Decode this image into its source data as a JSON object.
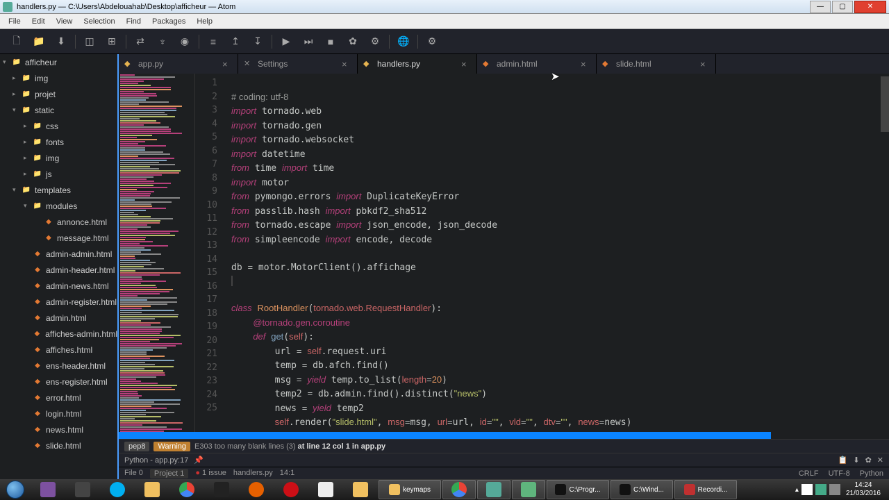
{
  "window": {
    "title": "handlers.py — C:\\Users\\Abdelouahab\\Desktop\\afficheur — Atom"
  },
  "menu": [
    "File",
    "Edit",
    "View",
    "Selection",
    "Find",
    "Packages",
    "Help"
  ],
  "tree": [
    {
      "l": "afficheur",
      "t": "folder",
      "i": 0,
      "c": "▾"
    },
    {
      "l": "img",
      "t": "folder",
      "i": 1,
      "c": "▸"
    },
    {
      "l": "projet",
      "t": "folder",
      "i": 1,
      "c": "▸"
    },
    {
      "l": "static",
      "t": "folder",
      "i": 1,
      "c": "▾"
    },
    {
      "l": "css",
      "t": "folder",
      "i": 2,
      "c": "▸"
    },
    {
      "l": "fonts",
      "t": "folder",
      "i": 2,
      "c": "▸"
    },
    {
      "l": "img",
      "t": "folder",
      "i": 2,
      "c": "▸"
    },
    {
      "l": "js",
      "t": "folder",
      "i": 2,
      "c": "▸"
    },
    {
      "l": "templates",
      "t": "folder",
      "i": 1,
      "c": "▾"
    },
    {
      "l": "modules",
      "t": "folder",
      "i": 2,
      "c": "▾"
    },
    {
      "l": "annonce.html",
      "t": "html",
      "i": 3,
      "c": ""
    },
    {
      "l": "message.html",
      "t": "html",
      "i": 3,
      "c": ""
    },
    {
      "l": "admin-admin.html",
      "t": "html",
      "i": 2,
      "c": ""
    },
    {
      "l": "admin-header.html",
      "t": "html",
      "i": 2,
      "c": ""
    },
    {
      "l": "admin-news.html",
      "t": "html",
      "i": 2,
      "c": ""
    },
    {
      "l": "admin-register.html",
      "t": "html",
      "i": 2,
      "c": ""
    },
    {
      "l": "admin.html",
      "t": "html",
      "i": 2,
      "c": ""
    },
    {
      "l": "affiches-admin.html",
      "t": "html",
      "i": 2,
      "c": ""
    },
    {
      "l": "affiches.html",
      "t": "html",
      "i": 2,
      "c": ""
    },
    {
      "l": "ens-header.html",
      "t": "html",
      "i": 2,
      "c": ""
    },
    {
      "l": "ens-register.html",
      "t": "html",
      "i": 2,
      "c": ""
    },
    {
      "l": "error.html",
      "t": "html",
      "i": 2,
      "c": ""
    },
    {
      "l": "login.html",
      "t": "html",
      "i": 2,
      "c": ""
    },
    {
      "l": "news.html",
      "t": "html",
      "i": 2,
      "c": ""
    },
    {
      "l": "slide.html",
      "t": "html",
      "i": 2,
      "c": ""
    }
  ],
  "tabs": [
    {
      "name": "app.py",
      "icon": "py",
      "active": false
    },
    {
      "name": "Settings",
      "icon": "settings",
      "active": false
    },
    {
      "name": "handlers.py",
      "icon": "py",
      "active": true
    },
    {
      "name": "admin.html",
      "icon": "html",
      "active": false
    },
    {
      "name": "slide.html",
      "icon": "html",
      "active": false
    }
  ],
  "lint": {
    "tool": "pep8",
    "level": "Warning",
    "msg": "E303 too many blank lines (3)",
    "loc": "at line 12 col 1 in app.py"
  },
  "term": {
    "label": "Python - app.py:17"
  },
  "status": {
    "file": "File 0",
    "project": "Project 1",
    "issues": "1 issue",
    "path": "handlers.py",
    "pos": "14:1",
    "eol": "CRLF",
    "enc": "UTF-8",
    "lang": "Python"
  },
  "taskbar": {
    "items": [
      "keymaps",
      "",
      "",
      "C:\\Progr...",
      "C:\\Wind...",
      "Recordi..."
    ],
    "time": "14:24",
    "date": "21/03/2016"
  },
  "code_lines": [
    "1",
    "2",
    "3",
    "4",
    "5",
    "6",
    "7",
    "8",
    "9",
    "10",
    "11",
    "12",
    "13",
    "14",
    "15",
    "16",
    "17",
    "18",
    "19",
    "20",
    "21",
    "22",
    "23",
    "24",
    "25"
  ]
}
